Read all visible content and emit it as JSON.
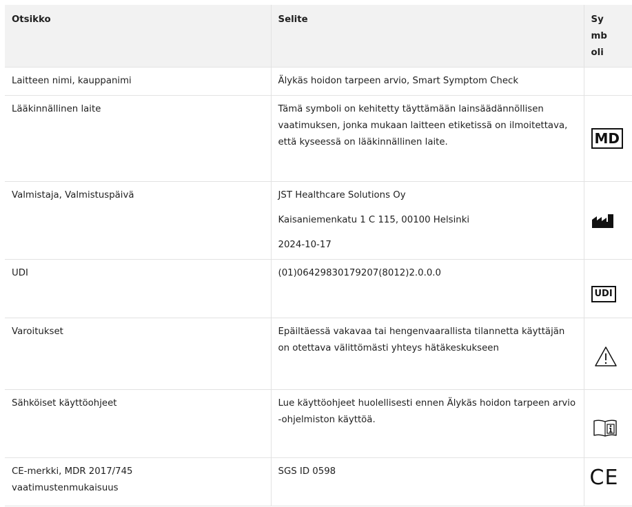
{
  "header": {
    "col1": "Otsikko",
    "col2": "Selite",
    "col3": "Symboli"
  },
  "rows": [
    {
      "title": "Laitteen nimi, kauppanimi",
      "description": [
        "Älykäs hoidon tarpeen arvio, Smart Symptom Check"
      ],
      "symbol": "none"
    },
    {
      "title": "Lääkinnällinen laite",
      "description": [
        "Tämä symboli on kehitetty täyttämään lainsäädännöllisen vaatimuksen, jonka mukaan laitteen etiketissä on ilmoitettava, että kyseessä on lääkinnällinen laite."
      ],
      "symbol": "md-icon",
      "symbol_text": "MD"
    },
    {
      "title": "Valmistaja, Valmistuspäivä",
      "description": [
        "JST Healthcare Solutions Oy",
        "Kaisaniemenkatu 1 C 115, 00100 Helsinki",
        "2024-10-17"
      ],
      "symbol": "manufacturer-icon"
    },
    {
      "title": "UDI",
      "description": [
        "(01)06429830179207(8012)2.0.0.0"
      ],
      "symbol": "udi-icon",
      "symbol_text": "UDI"
    },
    {
      "title": "Varoitukset",
      "description": [
        "Epäiltäessä vakavaa tai hengenvaarallista tilannetta käyttäjän on otettava välittömästi yhteys hätäkeskukseen"
      ],
      "symbol": "warning-icon"
    },
    {
      "title": "Sähköiset käyttöohjeet",
      "description": [
        "Lue käyttöohjeet huolellisesti ennen Älykäs hoidon tarpeen arvio -ohjelmiston käyttöä."
      ],
      "symbol": "instructions-icon"
    },
    {
      "title": "CE-merkki, MDR 2017/745 vaatimustenmukaisuus",
      "description": [
        "SGS ID 0598"
      ],
      "symbol": "ce-mark-icon",
      "symbol_text": "CE"
    }
  ]
}
